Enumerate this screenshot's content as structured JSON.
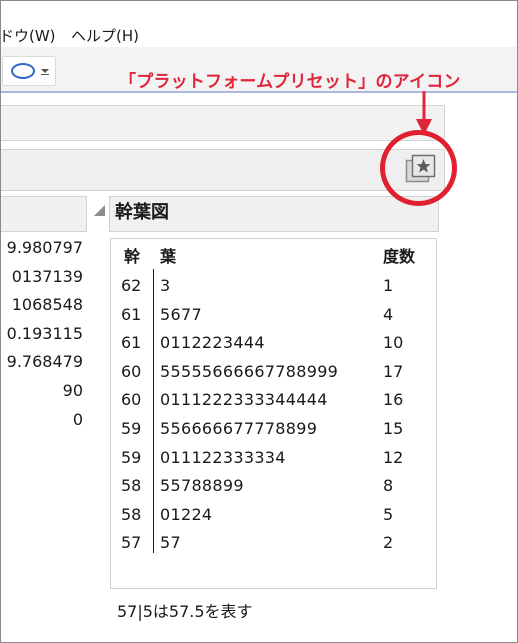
{
  "menu": {
    "window_partial": "ドウ(W)",
    "help": "ヘルプ(H)"
  },
  "toolbar": {
    "tool_icon": "ellipse-tool-icon"
  },
  "annotation": {
    "text": "「プラットフォームプリセット」のアイコン",
    "color": "#e0243a"
  },
  "preset_icon": "platform-preset-star-icon",
  "left_values": [
    "9.980797",
    "0137139",
    "1068548",
    "0.193115",
    "9.768479",
    "90",
    "0"
  ],
  "stem_leaf": {
    "title": "幹葉図",
    "headers": {
      "stem": "幹",
      "leaf": "葉",
      "count": "度数"
    },
    "rows": [
      {
        "stem": "62",
        "leaf": "3",
        "count": "1"
      },
      {
        "stem": "61",
        "leaf": "5677",
        "count": "4"
      },
      {
        "stem": "61",
        "leaf": "0112223444",
        "count": "10"
      },
      {
        "stem": "60",
        "leaf": "55555666667788999",
        "count": "17"
      },
      {
        "stem": "60",
        "leaf": "0111222333344444",
        "count": "16"
      },
      {
        "stem": "59",
        "leaf": "556666677778899",
        "count": "15"
      },
      {
        "stem": "59",
        "leaf": "011122333334",
        "count": "12"
      },
      {
        "stem": "58",
        "leaf": "55788899",
        "count": "8"
      },
      {
        "stem": "58",
        "leaf": "01224",
        "count": "5"
      },
      {
        "stem": "57",
        "leaf": "57",
        "count": "2"
      }
    ],
    "footnote": "57|5は57.5を表す"
  }
}
